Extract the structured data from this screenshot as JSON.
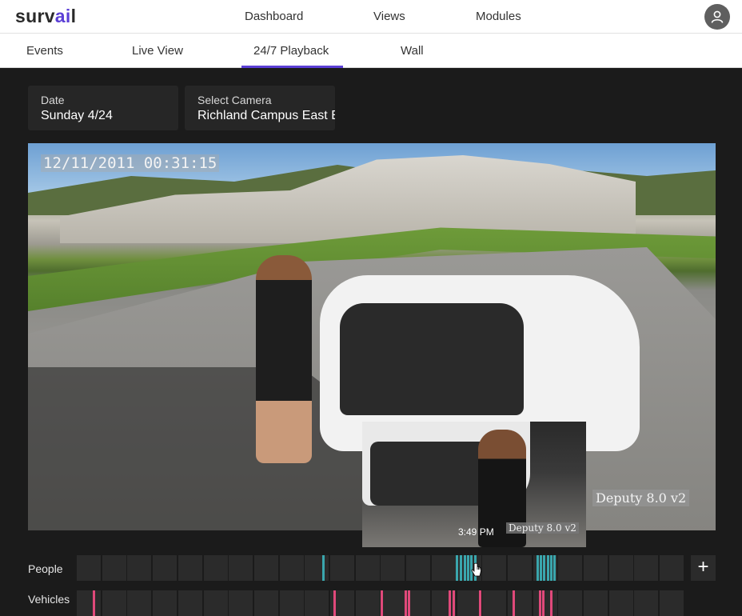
{
  "brand": {
    "logo_left": "surv",
    "logo_accent": "ai",
    "logo_right": "l"
  },
  "nav": {
    "items": [
      "Dashboard",
      "Views",
      "Modules"
    ]
  },
  "tabs": {
    "items": [
      "Events",
      "Live View",
      "24/7 Playback",
      "Wall"
    ],
    "active": "24/7 Playback"
  },
  "filters": {
    "date": {
      "label": "Date",
      "value": "Sunday 4/24"
    },
    "camera": {
      "label": "Select Camera",
      "value": "Richland Campus East Entrance"
    }
  },
  "player": {
    "osd_timestamp": "12/11/2011 00:31:15",
    "osd_source": "Deputy 8.0 v2",
    "hover_preview": {
      "time": "3:49 PM",
      "osd_source": "Deputy 8.0 v2"
    }
  },
  "timeline": {
    "tracks": [
      {
        "label": "People",
        "color": "#3aa6ad"
      },
      {
        "label": "Vehicles",
        "color": "#e0497a"
      }
    ],
    "add_label": "+"
  },
  "colors": {
    "accent": "#5b3fd6",
    "people": "#3aa6ad",
    "vehicles": "#e0497a",
    "background": "#1b1b1b"
  }
}
